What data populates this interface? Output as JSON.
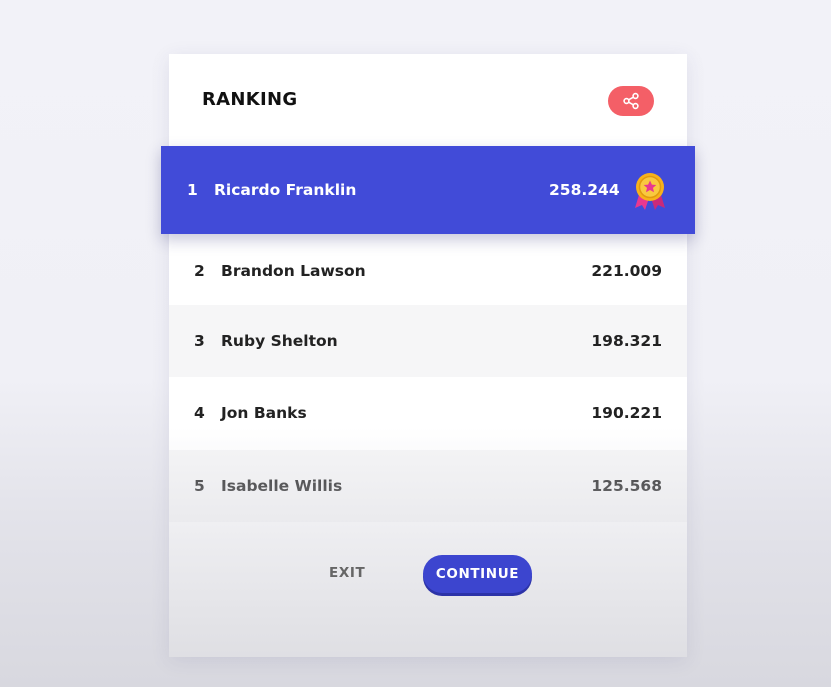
{
  "header": {
    "title": "RANKING",
    "share_icon": "share-icon"
  },
  "leader": {
    "rank": "1",
    "name": "Ricardo Franklin",
    "score": "258.244",
    "badge_icon": "medal-icon"
  },
  "rows": [
    {
      "rank": "2",
      "name": "Brandon Lawson",
      "score": "221.009"
    },
    {
      "rank": "3",
      "name": "Ruby Shelton",
      "score": "198.321"
    },
    {
      "rank": "4",
      "name": "Jon Banks",
      "score": "190.221"
    },
    {
      "rank": "5",
      "name": "Isabelle Willis",
      "score": "125.568"
    }
  ],
  "footer": {
    "exit_label": "EXIT",
    "continue_label": "CONTINUE"
  },
  "colors": {
    "accent": "#414bd8",
    "share": "#f45f67",
    "medal_gold": "#f7b21b",
    "medal_ribbon": "#e8388f"
  }
}
